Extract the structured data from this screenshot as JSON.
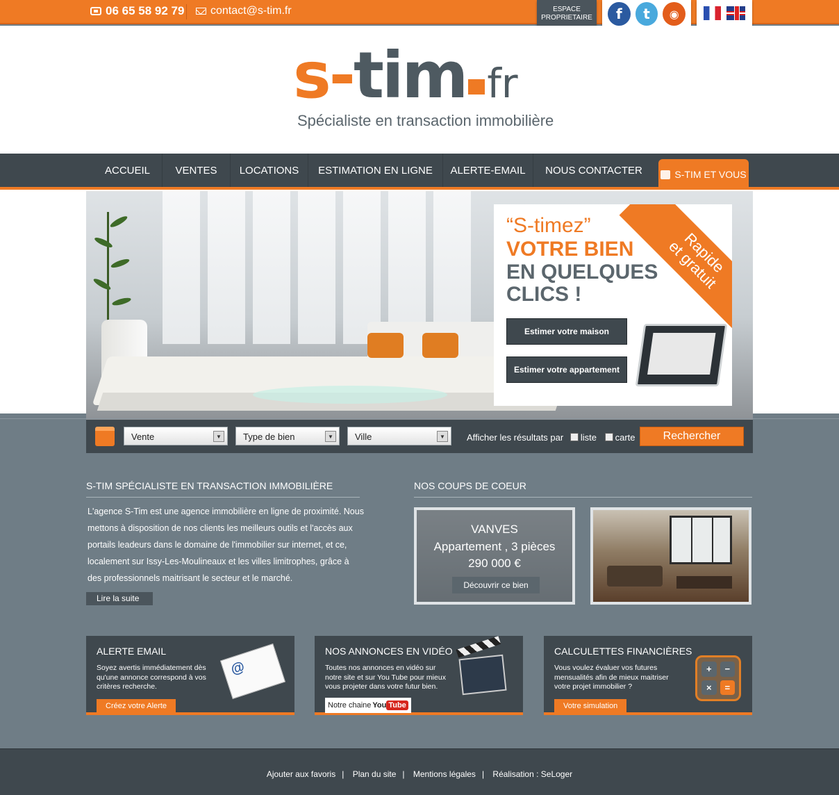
{
  "topbar": {
    "phone": "06 65 58 92 79",
    "email": "contact@s-tim.fr",
    "espace": "ESPACE PROPRIETAIRE",
    "social": [
      "facebook-icon",
      "twitter-icon",
      "rss-icon"
    ],
    "languages": [
      "fr-flag-icon",
      "uk-flag-icon"
    ]
  },
  "header": {
    "logo_main": "s-tim",
    "logo_tld": "fr",
    "tagline": "Spécialiste en transaction immobilière"
  },
  "nav": {
    "items": [
      "ACCUEIL",
      "VENTES",
      "LOCATIONS",
      "ESTIMATION EN LIGNE",
      "ALERTE-EMAIL",
      "NOUS CONTACTER"
    ],
    "special": "S-TIM ET VOUS"
  },
  "hero": {
    "line1": "“S-timez”",
    "line2": "VOTRE BIEN",
    "line3": "EN QUELQUES",
    "line4": "CLICS !",
    "ribbon_1": "Rapide",
    "ribbon_2": "et gratuit",
    "btn_maison": "Estimer votre maison",
    "btn_appartement": "Estimer votre appartement"
  },
  "search": {
    "select_1": "Vente",
    "select_2": "Type de bien",
    "select_3": "Ville",
    "afficher": "Afficher les résultats par",
    "opt_liste": "liste",
    "opt_carte": "carte",
    "button": "Rechercher"
  },
  "about": {
    "title": "S-TIM SPÉCIALISTE EN TRANSACTION IMMOBILIÈRE",
    "text": "L'agence S-Tim est une agence immobilière en ligne de proximité. Nous mettons à disposition de nos clients les meilleurs outils et l'accès aux portails leadeurs dans le domaine de l'immobilier sur internet, et ce, localement sur Issy-Les-Moulineaux et les villes limitrophes, grâce à des professionnels maitrisant le secteur et le marché.",
    "more": "Lire la suite"
  },
  "coups": {
    "title": "NOS COUPS DE COEUR",
    "city": "VANVES",
    "type": "Appartement , 3 pièces",
    "price": "290 000 €",
    "button": "Découvrir ce bien"
  },
  "boxes": {
    "alerte": {
      "title": "ALERTE EMAIL",
      "text": "Soyez avertis immédiatement dès qu'une annonce correspond à vos critères recherche.",
      "button": "Créez votre Alerte"
    },
    "video": {
      "title": "NOS ANNONCES EN VIDÉO",
      "text": "Toutes nos annonces en vidéo sur notre site et sur You Tube pour mieux vous projeter dans votre futur bien.",
      "button_prefix": "Notre chaine",
      "button_you": "You",
      "button_tube": "Tube"
    },
    "calc": {
      "title": "CALCULETTES FINANCIÈRES",
      "text": "Vous voulez évaluer vos futures mensualités afin de mieux maitriser votre projet immobilier ?",
      "button": "Votre simulation",
      "keys": [
        "+",
        "−",
        "×",
        "="
      ]
    }
  },
  "footer": {
    "links": [
      "Ajouter aux favoris",
      "Plan du site",
      "Mentions légales",
      "Réalisation : SeLoger"
    ]
  },
  "colors": {
    "accent": "#ef7a24",
    "dark": "#3f484e",
    "body": "#6f7d86"
  }
}
